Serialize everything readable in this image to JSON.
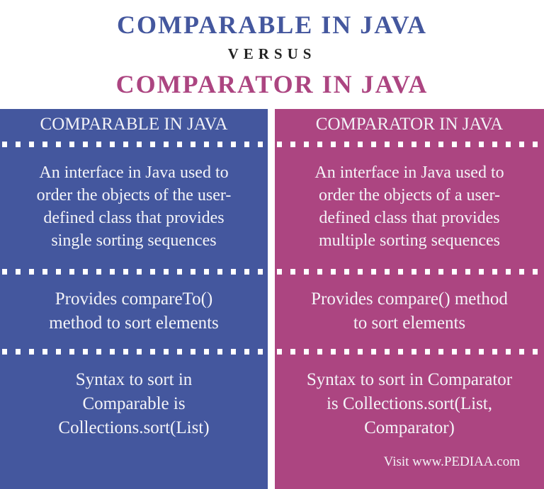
{
  "title": {
    "primary": "COMPARABLE IN JAVA",
    "versus": "VERSUS",
    "secondary": "COMPARATOR IN JAVA"
  },
  "colors": {
    "comparable": "#44579e",
    "comparator": "#ac4581"
  },
  "columns": [
    {
      "heading": "COMPARABLE IN JAVA",
      "rows": [
        [
          "An interface in Java used to",
          "order the objects of the user-",
          "defined class that provides",
          "single sorting sequences"
        ],
        [
          "Provides compareTo()",
          "method to sort elements"
        ],
        [
          "Syntax to sort in",
          "Comparable is",
          "Collections.sort(List)"
        ]
      ]
    },
    {
      "heading": "COMPARATOR IN JAVA",
      "rows": [
        [
          "An interface in Java used to",
          "order the objects of a user-",
          "defined class that provides",
          "multiple sorting sequences"
        ],
        [
          "Provides compare() method",
          "to sort elements"
        ],
        [
          "Syntax to sort in Comparator",
          "is Collections.sort(List,",
          "Comparator)"
        ]
      ]
    }
  ],
  "footer": "Visit www.PEDIAA.com"
}
